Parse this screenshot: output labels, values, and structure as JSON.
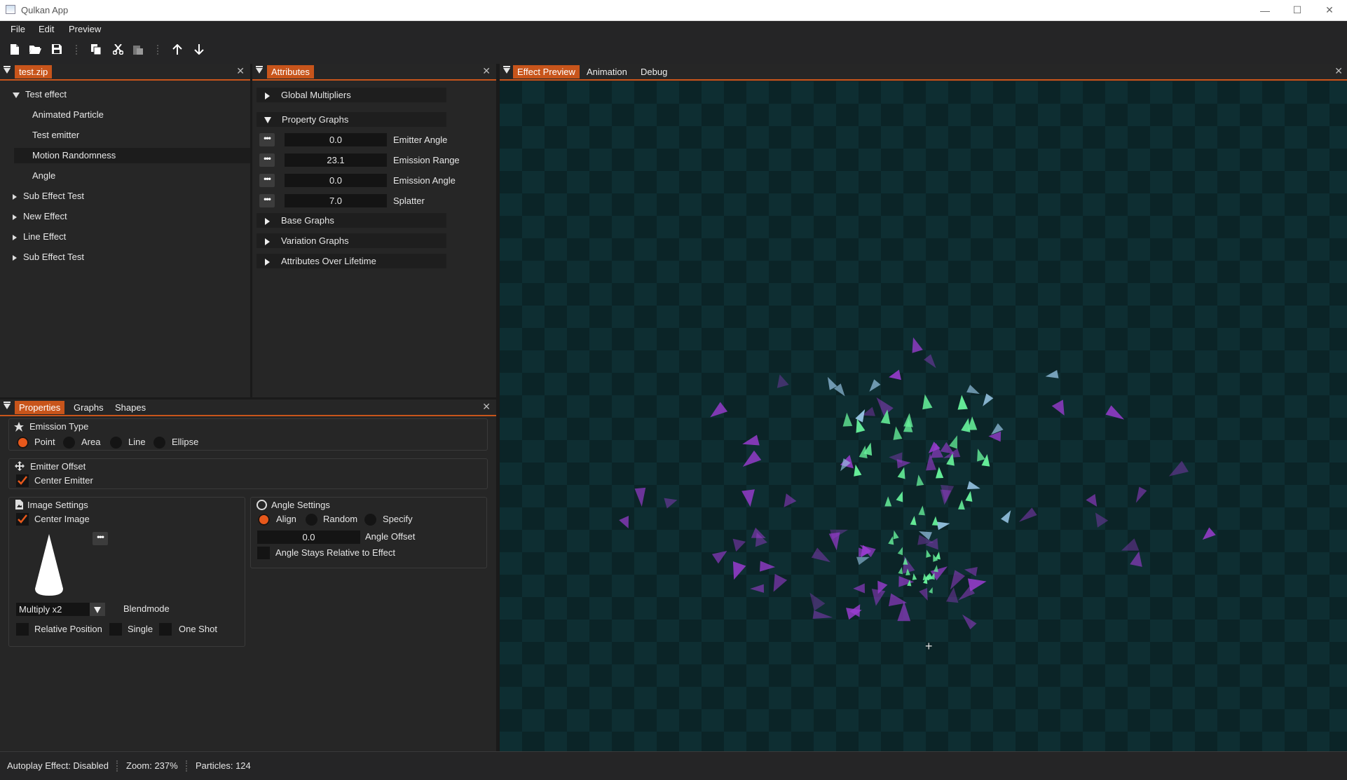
{
  "window": {
    "title": "Qulkan App",
    "minimize_glyph": "—",
    "maximize_glyph": "☐",
    "close_glyph": "✕"
  },
  "menu": {
    "items": [
      "File",
      "Edit",
      "Preview"
    ]
  },
  "toolbar": {
    "icons": [
      "new-file-icon",
      "open-folder-icon",
      "save-icon",
      "copy-icon",
      "cut-icon",
      "paste-icon",
      "move-up-icon",
      "move-down-icon"
    ]
  },
  "effects_panel": {
    "tab": "test.zip",
    "close_glyph": "✕",
    "tree": [
      {
        "label": "Test effect",
        "level": 0,
        "expanded": true
      },
      {
        "label": "Animated Particle",
        "level": 1
      },
      {
        "label": "Test emitter",
        "level": 1
      },
      {
        "label": "Motion Randomness",
        "level": 1,
        "selected": true
      },
      {
        "label": "Angle",
        "level": 1
      },
      {
        "label": "Sub Effect Test",
        "level": 0,
        "expanded": false
      },
      {
        "label": "New Effect",
        "level": 0,
        "expanded": false
      },
      {
        "label": "Line Effect",
        "level": 0,
        "expanded": false
      },
      {
        "label": "Sub Effect Test",
        "level": 0,
        "expanded": false
      }
    ]
  },
  "attributes_panel": {
    "tab": "Attributes",
    "close_glyph": "✕",
    "sections": {
      "global_multipliers": "Global Multipliers",
      "property_graphs": "Property Graphs",
      "base_graphs": "Base Graphs",
      "variation_graphs": "Variation Graphs",
      "attributes_over_lifetime": "Attributes Over Lifetime"
    },
    "dots_glyph": "•••",
    "property_graphs": [
      {
        "value": "0.0",
        "label": "Emitter Angle"
      },
      {
        "value": "23.1",
        "label": "Emission Range"
      },
      {
        "value": "0.0",
        "label": "Emission Angle"
      },
      {
        "value": "7.0",
        "label": "Splatter"
      }
    ]
  },
  "properties_panel": {
    "tabs": [
      "Properties",
      "Graphs",
      "Shapes"
    ],
    "active_tab": "Properties",
    "close_glyph": "✕",
    "emission_type": {
      "title": "Emission Type",
      "options": [
        "Point",
        "Area",
        "Line",
        "Ellipse"
      ],
      "selected": "Point"
    },
    "emitter_offset": {
      "title": "Emitter Offset",
      "center_emitter": "Center Emitter",
      "center_emitter_checked": true
    },
    "image_settings": {
      "title": "Image Settings",
      "center_image": "Center Image",
      "center_image_checked": true,
      "dots_glyph": "•••",
      "blendmode_value": "Multiply x2",
      "blendmode_label": "Blendmode",
      "relative_position": "Relative Position",
      "single": "Single",
      "one_shot": "One Shot"
    },
    "angle_settings": {
      "title": "Angle Settings",
      "options": [
        "Align",
        "Random",
        "Specify"
      ],
      "selected": "Align",
      "angle_offset_value": "0.0",
      "angle_offset_label": "Angle Offset",
      "relative_label": "Angle Stays Relative to Effect"
    }
  },
  "preview_panel": {
    "tabs": [
      "Effect Preview",
      "Animation",
      "Debug"
    ],
    "active_tab": "Effect Preview",
    "close_glyph": "✕",
    "emitter_marker": "+",
    "colors": {
      "purple": "#9a3cd0",
      "green": "#66f09a",
      "blue": "#9ac8e8",
      "background": "#0b2427"
    }
  },
  "status": {
    "autoplay": "Autoplay Effect: Disabled",
    "zoom": "Zoom: 237%",
    "particles": "Particles: 124"
  }
}
